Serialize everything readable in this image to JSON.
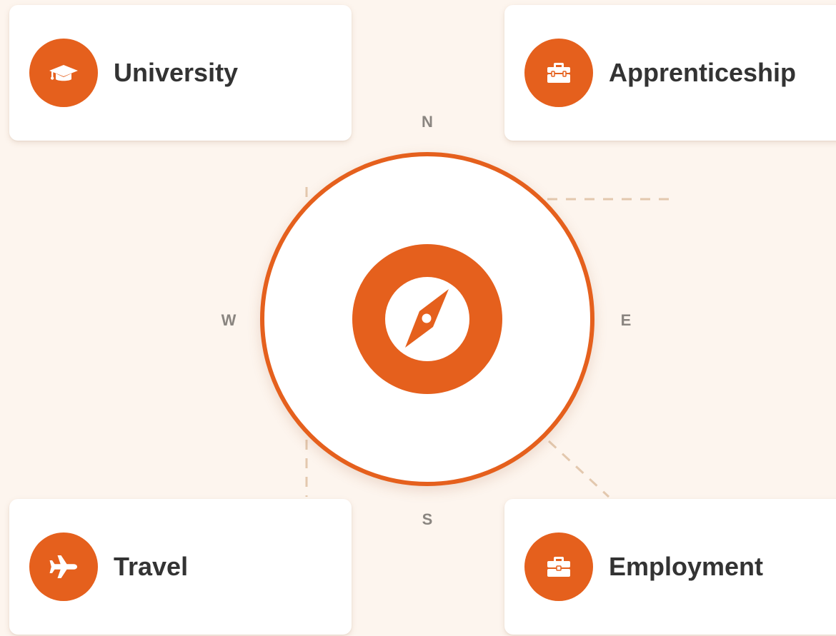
{
  "destinations": [
    {
      "label": "University",
      "icon": "graduation-cap-icon"
    },
    {
      "label": "Apprenticeship",
      "icon": "toolbox-icon"
    },
    {
      "label": "Travel",
      "icon": "airplane-icon"
    },
    {
      "label": "Employment",
      "icon": "briefcase-icon"
    }
  ],
  "compass": {
    "center_icon": "compass-icon",
    "north": "N",
    "south": "S",
    "west": "W",
    "east": "E"
  },
  "colors": {
    "accent": "#e5601d",
    "background": "#fdf5ee",
    "card": "#ffffff",
    "text": "#333333",
    "cardinal_text": "#8a8580",
    "connector": "#e3c8ae"
  }
}
